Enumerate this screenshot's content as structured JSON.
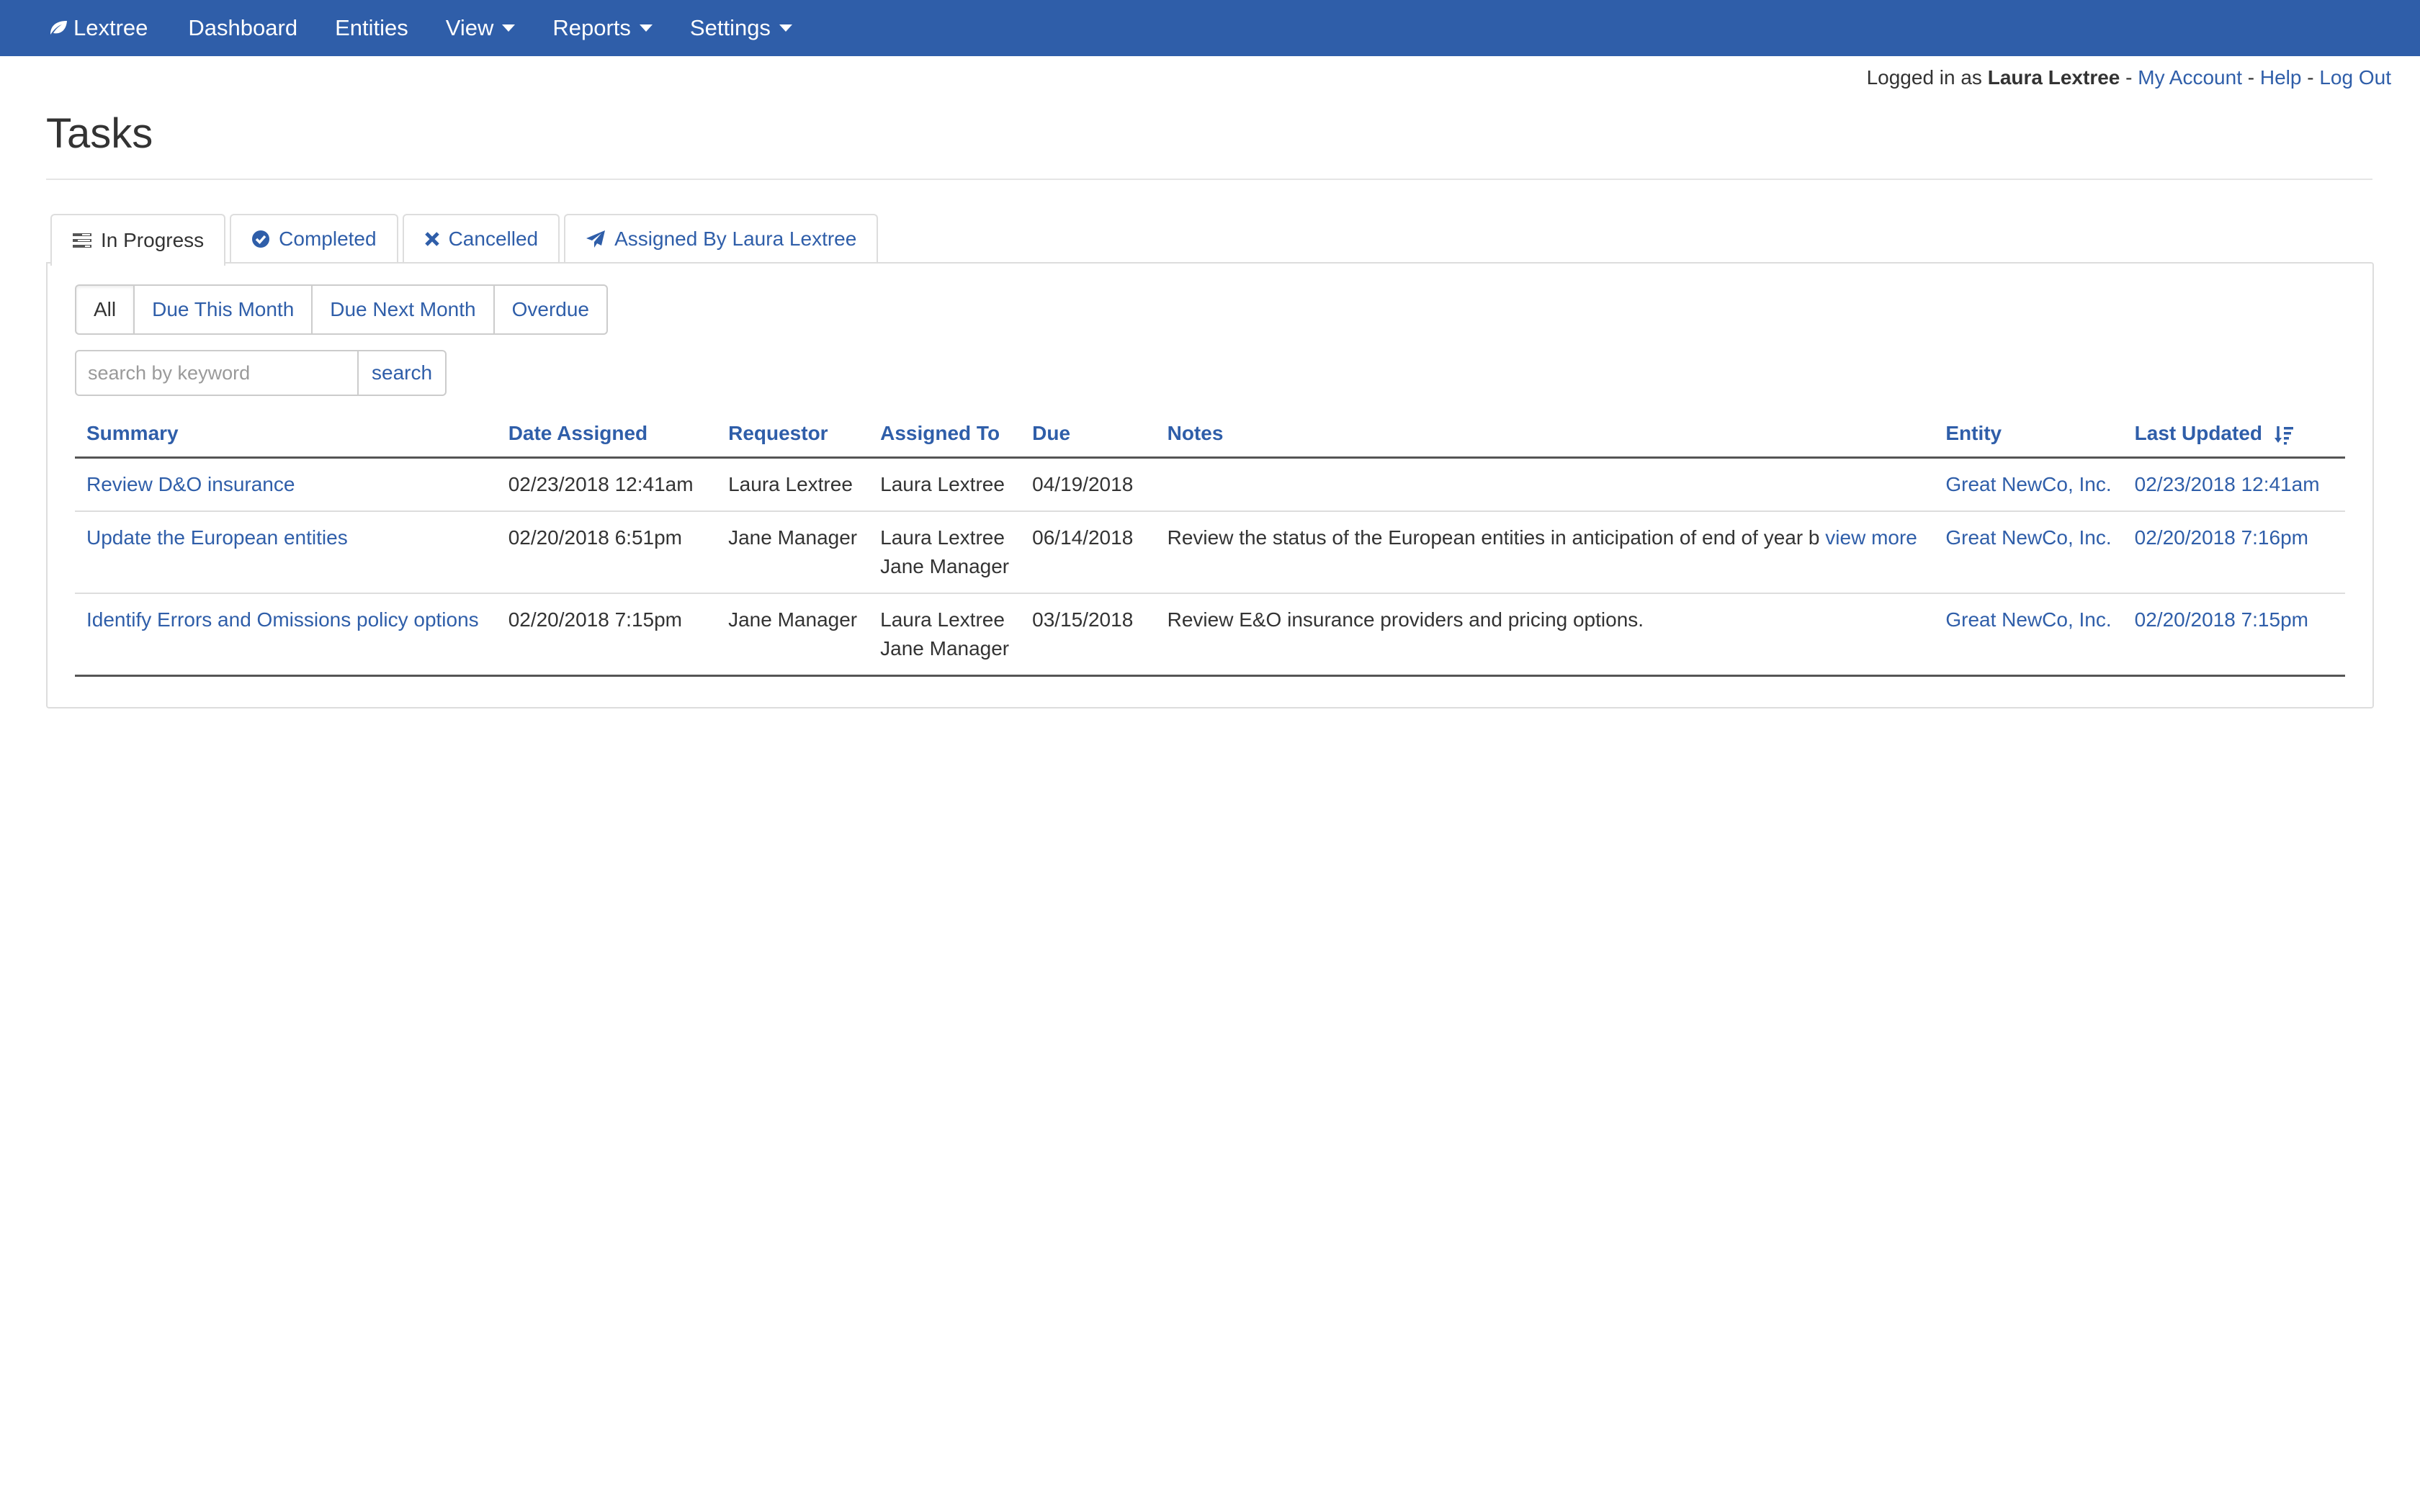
{
  "nav": {
    "brand": "Lextree",
    "items": [
      {
        "label": "Dashboard",
        "dropdown": false
      },
      {
        "label": "Entities",
        "dropdown": false
      },
      {
        "label": "View",
        "dropdown": true
      },
      {
        "label": "Reports",
        "dropdown": true
      },
      {
        "label": "Settings",
        "dropdown": true
      }
    ]
  },
  "userbar": {
    "prefix": "Logged in as",
    "user": "Laura Lextree",
    "sep": "-",
    "my_account": "My Account",
    "help": "Help",
    "logout": "Log Out"
  },
  "page": {
    "title": "Tasks"
  },
  "tabs": [
    {
      "label": "In Progress",
      "icon": "tasks-icon",
      "active": true
    },
    {
      "label": "Completed",
      "icon": "check-circle-icon",
      "active": false
    },
    {
      "label": "Cancelled",
      "icon": "close-icon",
      "active": false
    },
    {
      "label": "Assigned By Laura Lextree",
      "icon": "send-icon",
      "active": false
    }
  ],
  "filters": [
    {
      "label": "All",
      "active": true
    },
    {
      "label": "Due This Month",
      "active": false
    },
    {
      "label": "Due Next Month",
      "active": false
    },
    {
      "label": "Overdue",
      "active": false
    }
  ],
  "search": {
    "placeholder": "search by keyword",
    "button": "search"
  },
  "table": {
    "headers": {
      "summary": "Summary",
      "date_assigned": "Date Assigned",
      "requestor": "Requestor",
      "assigned_to": "Assigned To",
      "due": "Due",
      "notes": "Notes",
      "entity": "Entity",
      "last_updated": "Last Updated"
    },
    "rows": [
      {
        "summary": "Review D&O insurance",
        "date_assigned": "02/23/2018 12:41am",
        "requestor": "Laura Lextree",
        "assigned_to": [
          "Laura Lextree"
        ],
        "due": "04/19/2018",
        "notes": "",
        "view_more": "",
        "entity": "Great NewCo, Inc.",
        "last_updated": "02/23/2018 12:41am"
      },
      {
        "summary": "Update the European entities",
        "date_assigned": "02/20/2018 6:51pm",
        "requestor": "Jane Manager",
        "assigned_to": [
          "Laura Lextree",
          "Jane Manager"
        ],
        "due": "06/14/2018",
        "notes": "Review the status of the European entities in anticipation of end of year b",
        "view_more": "view more",
        "entity": "Great NewCo, Inc.",
        "last_updated": "02/20/2018 7:16pm"
      },
      {
        "summary": "Identify Errors and Omissions policy options",
        "date_assigned": "02/20/2018 7:15pm",
        "requestor": "Jane Manager",
        "assigned_to": [
          "Laura Lextree",
          "Jane Manager"
        ],
        "due": "03/15/2018",
        "notes": "Review E&O insurance providers and pricing options.",
        "view_more": "",
        "entity": "Great NewCo, Inc.",
        "last_updated": "02/20/2018 7:15pm"
      }
    ]
  },
  "colors": {
    "navbar": "#2f5ea9",
    "link": "#2f5ea9",
    "text": "#333333"
  }
}
